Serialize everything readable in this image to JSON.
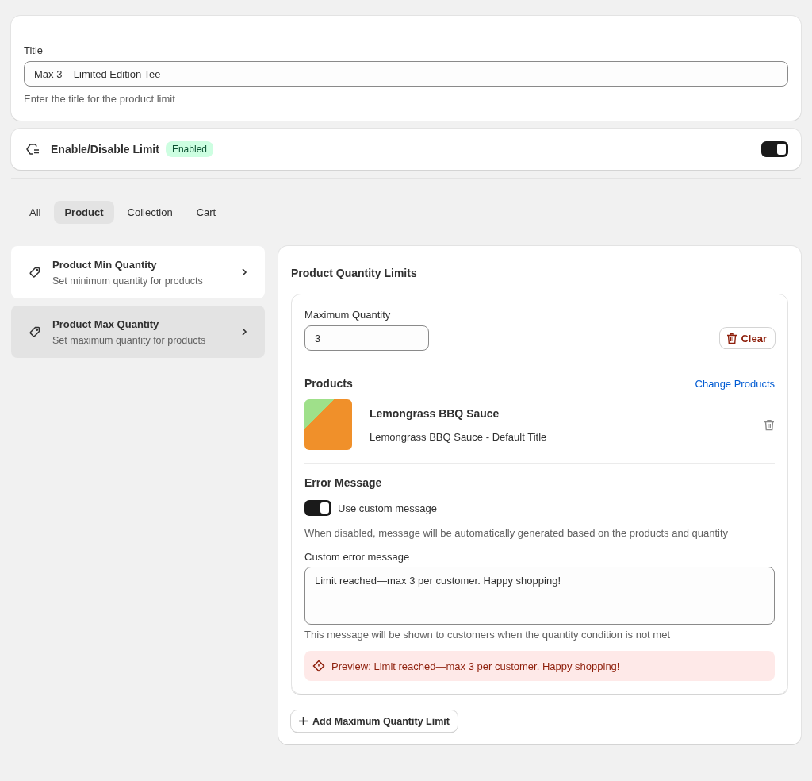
{
  "title_card": {
    "label": "Title",
    "value": "Max 3 – Limited Edition Tee",
    "help": "Enter the title for the product limit"
  },
  "limit_toggle": {
    "label": "Enable/Disable Limit",
    "badge": "Enabled",
    "on": true
  },
  "tabs": [
    {
      "label": "All",
      "selected": false
    },
    {
      "label": "Product",
      "selected": true
    },
    {
      "label": "Collection",
      "selected": false
    },
    {
      "label": "Cart",
      "selected": false
    }
  ],
  "rule_types": [
    {
      "title": "Product Min Quantity",
      "subtitle": "Set minimum quantity for products",
      "selected": false
    },
    {
      "title": "Product Max Quantity",
      "subtitle": "Set maximum quantity for products",
      "selected": true
    }
  ],
  "panel": {
    "title": "Product Quantity Limits",
    "limit": {
      "quantity_label": "Maximum Quantity",
      "quantity_value": "3",
      "clear_button": "Clear",
      "products_heading": "Products",
      "change_link": "Change Products",
      "products": [
        {
          "name": "Lemongrass BBQ Sauce",
          "variant": "Lemongrass BBQ Sauce - Default Title"
        }
      ],
      "error_heading": "Error Message",
      "custom_toggle": {
        "label": "Use custom message",
        "on": true
      },
      "custom_help": "When disabled, message will be automatically generated based on the products and quantity",
      "message_label": "Custom error message",
      "message_value": "Limit reached—max 3 per customer. Happy shopping!",
      "message_help": "This message will be shown to customers when the quantity condition is not met",
      "preview": "Preview: Limit reached—max 3 per customer. Happy shopping!"
    },
    "add_button": "Add Maximum Quantity Limit"
  }
}
